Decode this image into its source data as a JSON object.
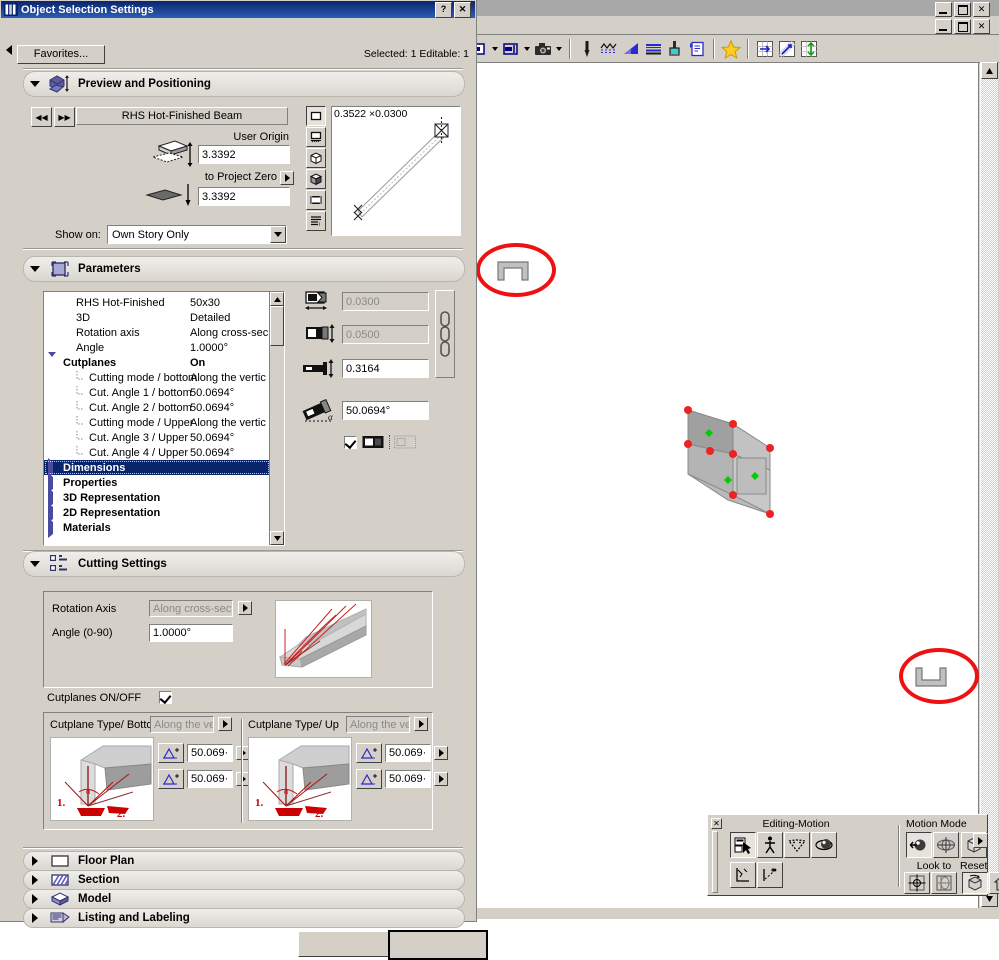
{
  "dialog": {
    "title": "Object Selection Settings",
    "help_label": "?",
    "close_label": "✕",
    "favorites_label": "Favorites...",
    "selected_info": "Selected: 1 Editable: 1"
  },
  "sections": {
    "preview": {
      "label": "Preview and Positioning",
      "expanded": true,
      "object_name": "RHS Hot-Finished Beam",
      "prev_label": "◀◀",
      "next_label": "▶▶",
      "user_origin_label": "User Origin",
      "user_origin_value": "3.3392",
      "project_zero_label": "to Project Zero",
      "project_zero_value": "3.3392",
      "show_on_label": "Show on:",
      "show_on_value": "Own Story Only",
      "preview_size": "0.3522 ×0.0300",
      "view_buttons": [
        "2d-symbol-view-icon",
        "floor-plan-view-icon",
        "3d-wireframe-view-icon",
        "3d-shaded-view-icon",
        "preview-picture-icon",
        "parameter-list-icon"
      ]
    },
    "parameters": {
      "label": "Parameters",
      "expanded": true,
      "tree": [
        {
          "name": "RHS Hot-Finished",
          "value": "50x30",
          "indent": 1,
          "bold": false,
          "tri": "none"
        },
        {
          "name": "3D",
          "value": "Detailed",
          "indent": 1,
          "bold": false,
          "tri": "none"
        },
        {
          "name": "Rotation axis",
          "value": "Along cross-sec",
          "indent": 1,
          "bold": false,
          "tri": "none"
        },
        {
          "name": "Angle",
          "value": "1.0000°",
          "indent": 1,
          "bold": false,
          "tri": "none"
        },
        {
          "name": "Cutplanes",
          "value": "On",
          "indent": 0,
          "bold": true,
          "tri": "open"
        },
        {
          "name": "Cutting mode / bottom",
          "value": "Along the vertic",
          "indent": 2,
          "bold": false,
          "tri": "leaf"
        },
        {
          "name": "Cut. Angle 1 / bottom",
          "value": "50.0694°",
          "indent": 2,
          "bold": false,
          "tri": "leaf"
        },
        {
          "name": "Cut. Angle 2 / bottom",
          "value": "50.0694°",
          "indent": 2,
          "bold": false,
          "tri": "leaf"
        },
        {
          "name": "Cutting mode / Upper",
          "value": "Along the vertic",
          "indent": 2,
          "bold": false,
          "tri": "leaf"
        },
        {
          "name": "Cut. Angle 3 / Upper",
          "value": "50.0694°",
          "indent": 2,
          "bold": false,
          "tri": "leaf"
        },
        {
          "name": "Cut. Angle 4 / Upper",
          "value": "50.0694°",
          "indent": 2,
          "bold": false,
          "tri": "leaf"
        },
        {
          "name": "Dimensions",
          "value": "",
          "indent": 0,
          "bold": true,
          "tri": "closed",
          "selected": true
        },
        {
          "name": "Properties",
          "value": "",
          "indent": 0,
          "bold": true,
          "tri": "closed"
        },
        {
          "name": "3D Representation",
          "value": "",
          "indent": 0,
          "bold": true,
          "tri": "closed"
        },
        {
          "name": "2D Representation",
          "value": "",
          "indent": 0,
          "bold": true,
          "tri": "closed"
        },
        {
          "name": "Materials",
          "value": "",
          "indent": 0,
          "bold": true,
          "tri": "closed"
        }
      ],
      "fields": {
        "width_value": "0.0300",
        "width_disabled": true,
        "height_value": "0.0500",
        "height_disabled": true,
        "length_value": "0.3164",
        "length_disabled": false,
        "angle_value": "50.0694°",
        "checkbox_checked": true
      }
    },
    "cutting": {
      "label": "Cutting Settings",
      "expanded": true,
      "rotation_axis_label": "Rotation Axis",
      "rotation_axis_value": "Along cross-sectio",
      "angle_label": "Angle (0-90)",
      "angle_value": "1.0000°",
      "cutplanes_onoff_label": "Cutplanes ON/OFF",
      "cutplanes_onoff_checked": true,
      "bottom": {
        "title": "Cutplane Type/ Bottom",
        "type_value": "Along the vert",
        "angle1": "50.069·",
        "angle2": "50.069·"
      },
      "up": {
        "title": "Cutplane Type/ Up",
        "type_value": "Along the vert",
        "angle1": "50.069·",
        "angle2": "50.069·"
      }
    },
    "collapsed": [
      {
        "label": "Floor Plan",
        "icon": "floor-plan-icon"
      },
      {
        "label": "Section",
        "icon": "section-hatch-icon"
      },
      {
        "label": "Model",
        "icon": "model-icon"
      },
      {
        "label": "Listing and Labeling",
        "icon": "listing-labeling-icon"
      }
    ]
  },
  "app_window": {
    "minimize_label": "_",
    "maximize_label": "❐",
    "close_label": "✕",
    "toolbar_icons": [
      "view-dropdown-icon",
      "align-icon",
      "camera-icon",
      "pen-tool-icon",
      "fill-pattern-icon",
      "gradient-fill-icon",
      "line-pattern-icon",
      "paint-bucket-icon",
      "document-icon",
      "favorites-star-icon",
      "grid-snap-icon",
      "magnet-snap-icon",
      "elevation-snap-icon"
    ]
  },
  "palette": {
    "close_label": "✕",
    "editing_motion_label": "Editing-Motion",
    "motion_mode_label": "Motion Mode",
    "look_to_label": "Look to",
    "reset_label": "Reset",
    "buttons": [
      "select-drag-icon",
      "walk-icon",
      "fly-icon",
      "orbit-icon",
      "explore-icon",
      "path-icon",
      "rotate-camera-icon",
      "globe-view-icon",
      "cube-view-icon",
      "target-center-icon",
      "perspective-icon",
      "reset-view-icon",
      "home-view-icon",
      "undo-view-icon",
      "expand-palette-icon"
    ]
  },
  "viewport": {
    "annotations": [
      {
        "name": "top-cutplane-highlight",
        "shape": "inverted-u-icon"
      },
      {
        "name": "bottom-cutplane-highlight",
        "shape": "u-icon"
      }
    ],
    "selected_object": "rhs-beam-3d",
    "hotspot_color": "#ee2222",
    "node_color": "#00cc00",
    "highlight_color": "#ee1111"
  }
}
